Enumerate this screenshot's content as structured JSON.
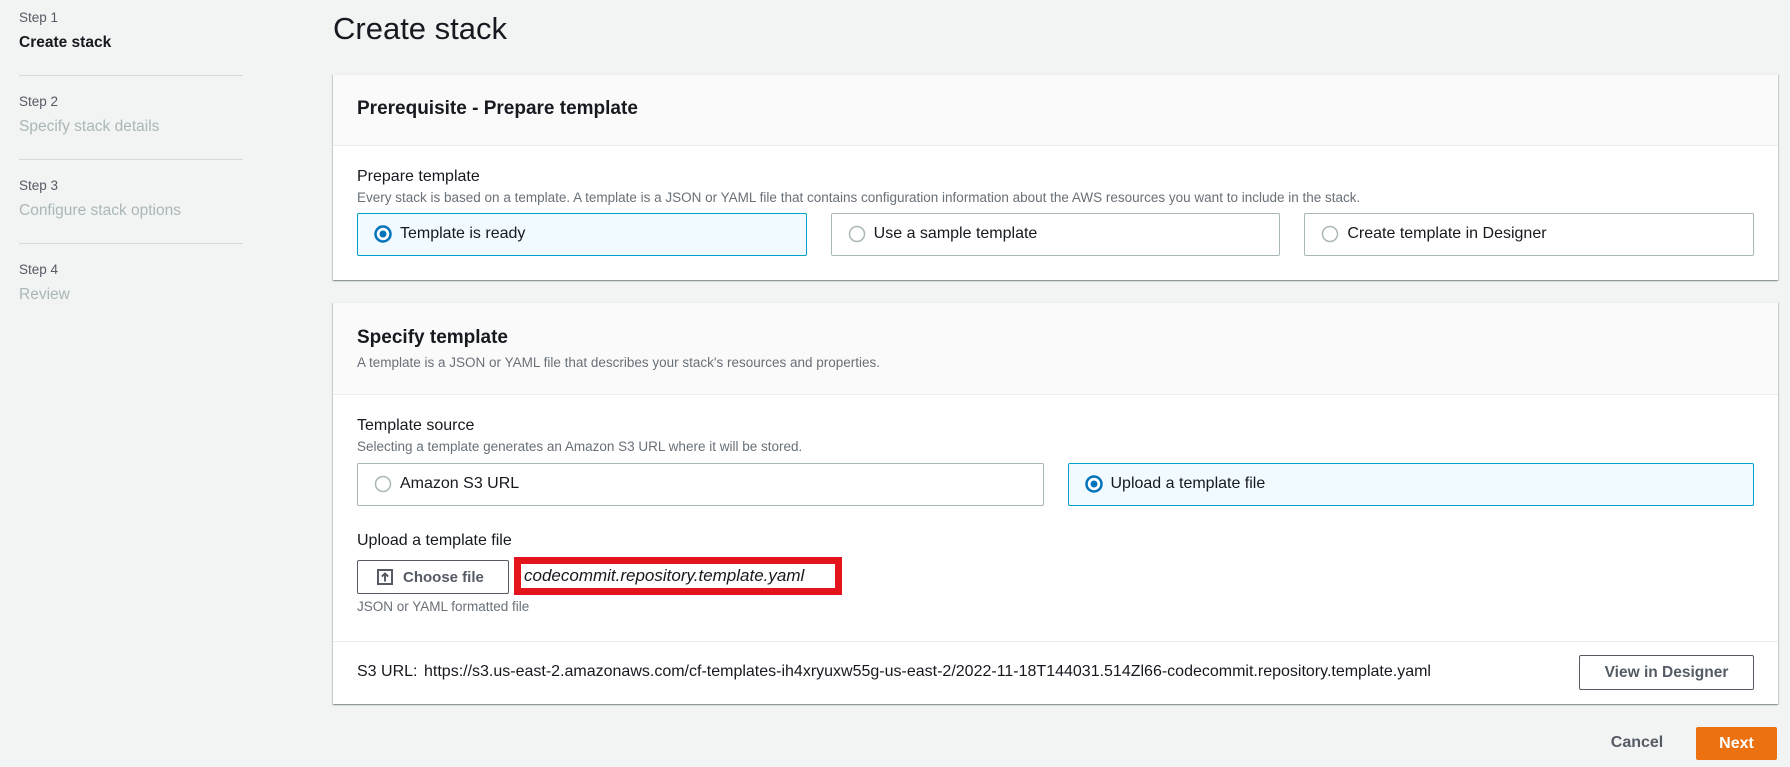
{
  "sidebar": {
    "steps": [
      {
        "step": "Step 1",
        "label": "Create stack",
        "current": true
      },
      {
        "step": "Step 2",
        "label": "Specify stack details",
        "current": false
      },
      {
        "step": "Step 3",
        "label": "Configure stack options",
        "current": false
      },
      {
        "step": "Step 4",
        "label": "Review",
        "current": false
      }
    ]
  },
  "page": {
    "title": "Create stack"
  },
  "prerequisite": {
    "title": "Prerequisite - Prepare template",
    "field_label": "Prepare template",
    "field_description": "Every stack is based on a template. A template is a JSON or YAML file that contains configuration information about the AWS resources you want to include in the stack.",
    "options": [
      {
        "label": "Template is ready",
        "selected": true
      },
      {
        "label": "Use a sample template",
        "selected": false
      },
      {
        "label": "Create template in Designer",
        "selected": false
      }
    ]
  },
  "specify": {
    "title": "Specify template",
    "description": "A template is a JSON or YAML file that describes your stack's resources and properties.",
    "source_label": "Template source",
    "source_description": "Selecting a template generates an Amazon S3 URL where it will be stored.",
    "source_options": [
      {
        "label": "Amazon S3 URL",
        "selected": false
      },
      {
        "label": "Upload a template file",
        "selected": true
      }
    ],
    "upload_label": "Upload a template file",
    "choose_file_label": "Choose file",
    "choose_file_icon": "upload-icon",
    "file_name": "codecommit.repository.template.yaml",
    "upload_hint": "JSON or YAML formatted file",
    "s3_url_label": "S3 URL:",
    "s3_url": "https://s3.us-east-2.amazonaws.com/cf-templates-ih4xryuxw55g-us-east-2/2022-11-18T144031.514Zl66-codecommit.repository.template.yaml",
    "view_designer_label": "View in Designer"
  },
  "footer": {
    "cancel_label": "Cancel",
    "next_label": "Next"
  },
  "colors": {
    "page_background": "#f2f3f3",
    "primary_button": "#ec7211",
    "selected_radio": "#0073bb",
    "selected_tile_border": "#00a1c9",
    "selected_tile_background": "#f1faff",
    "highlight_box": "#e3141c"
  }
}
